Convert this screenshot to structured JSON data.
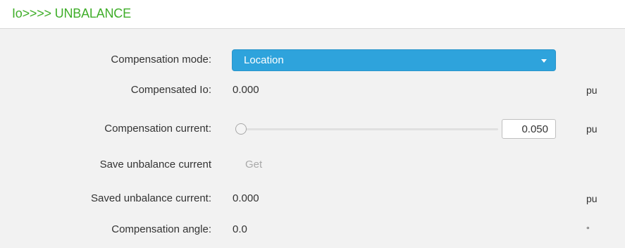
{
  "header": {
    "title": "Io>>>> UNBALANCE"
  },
  "rows": {
    "compensation_mode": {
      "label": "Compensation mode:",
      "selected": "Location"
    },
    "compensated_io": {
      "label": "Compensated Io:",
      "value": "0.000",
      "unit": "pu"
    },
    "compensation_current": {
      "label": "Compensation current:",
      "value": "0.050",
      "unit": "pu",
      "slider_fraction": 0.0
    },
    "save_unbalance_current": {
      "label": "Save unbalance current",
      "button": "Get"
    },
    "saved_unbalance_current": {
      "label": "Saved unbalance current:",
      "value": "0.000",
      "unit": "pu"
    },
    "compensation_angle": {
      "label": "Compensation angle:",
      "value": "0.0",
      "unit": "°"
    }
  },
  "colors": {
    "header_title": "#3fae29",
    "select_background": "#2ea3dc",
    "background": "#f2f2f2"
  }
}
